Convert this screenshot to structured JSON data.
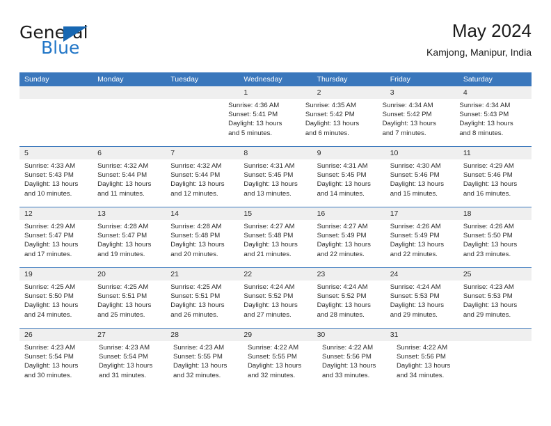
{
  "brand": {
    "word_top": "General",
    "word_bottom": "Blue",
    "accent_color": "#2176c7",
    "triangle_color": "#1767b2"
  },
  "header": {
    "title": "May 2024",
    "subtitle": "Kamjong, Manipur, India"
  },
  "theme": {
    "header_bar_color": "#3a77bc",
    "row_strip_color": "#efefef",
    "text_color": "#2b2b2b"
  },
  "weekday_headers": [
    "Sunday",
    "Monday",
    "Tuesday",
    "Wednesday",
    "Thursday",
    "Friday",
    "Saturday"
  ],
  "weeks": [
    {
      "days": [
        {
          "number": "",
          "sunrise": "",
          "sunset": "",
          "daylight_line1": "",
          "daylight_line2": ""
        },
        {
          "number": "",
          "sunrise": "",
          "sunset": "",
          "daylight_line1": "",
          "daylight_line2": ""
        },
        {
          "number": "",
          "sunrise": "",
          "sunset": "",
          "daylight_line1": "",
          "daylight_line2": ""
        },
        {
          "number": "1",
          "sunrise": "Sunrise: 4:36 AM",
          "sunset": "Sunset: 5:41 PM",
          "daylight_line1": "Daylight: 13 hours",
          "daylight_line2": "and 5 minutes."
        },
        {
          "number": "2",
          "sunrise": "Sunrise: 4:35 AM",
          "sunset": "Sunset: 5:42 PM",
          "daylight_line1": "Daylight: 13 hours",
          "daylight_line2": "and 6 minutes."
        },
        {
          "number": "3",
          "sunrise": "Sunrise: 4:34 AM",
          "sunset": "Sunset: 5:42 PM",
          "daylight_line1": "Daylight: 13 hours",
          "daylight_line2": "and 7 minutes."
        },
        {
          "number": "4",
          "sunrise": "Sunrise: 4:34 AM",
          "sunset": "Sunset: 5:43 PM",
          "daylight_line1": "Daylight: 13 hours",
          "daylight_line2": "and 8 minutes."
        }
      ]
    },
    {
      "days": [
        {
          "number": "5",
          "sunrise": "Sunrise: 4:33 AM",
          "sunset": "Sunset: 5:43 PM",
          "daylight_line1": "Daylight: 13 hours",
          "daylight_line2": "and 10 minutes."
        },
        {
          "number": "6",
          "sunrise": "Sunrise: 4:32 AM",
          "sunset": "Sunset: 5:44 PM",
          "daylight_line1": "Daylight: 13 hours",
          "daylight_line2": "and 11 minutes."
        },
        {
          "number": "7",
          "sunrise": "Sunrise: 4:32 AM",
          "sunset": "Sunset: 5:44 PM",
          "daylight_line1": "Daylight: 13 hours",
          "daylight_line2": "and 12 minutes."
        },
        {
          "number": "8",
          "sunrise": "Sunrise: 4:31 AM",
          "sunset": "Sunset: 5:45 PM",
          "daylight_line1": "Daylight: 13 hours",
          "daylight_line2": "and 13 minutes."
        },
        {
          "number": "9",
          "sunrise": "Sunrise: 4:31 AM",
          "sunset": "Sunset: 5:45 PM",
          "daylight_line1": "Daylight: 13 hours",
          "daylight_line2": "and 14 minutes."
        },
        {
          "number": "10",
          "sunrise": "Sunrise: 4:30 AM",
          "sunset": "Sunset: 5:46 PM",
          "daylight_line1": "Daylight: 13 hours",
          "daylight_line2": "and 15 minutes."
        },
        {
          "number": "11",
          "sunrise": "Sunrise: 4:29 AM",
          "sunset": "Sunset: 5:46 PM",
          "daylight_line1": "Daylight: 13 hours",
          "daylight_line2": "and 16 minutes."
        }
      ]
    },
    {
      "days": [
        {
          "number": "12",
          "sunrise": "Sunrise: 4:29 AM",
          "sunset": "Sunset: 5:47 PM",
          "daylight_line1": "Daylight: 13 hours",
          "daylight_line2": "and 17 minutes."
        },
        {
          "number": "13",
          "sunrise": "Sunrise: 4:28 AM",
          "sunset": "Sunset: 5:47 PM",
          "daylight_line1": "Daylight: 13 hours",
          "daylight_line2": "and 19 minutes."
        },
        {
          "number": "14",
          "sunrise": "Sunrise: 4:28 AM",
          "sunset": "Sunset: 5:48 PM",
          "daylight_line1": "Daylight: 13 hours",
          "daylight_line2": "and 20 minutes."
        },
        {
          "number": "15",
          "sunrise": "Sunrise: 4:27 AM",
          "sunset": "Sunset: 5:48 PM",
          "daylight_line1": "Daylight: 13 hours",
          "daylight_line2": "and 21 minutes."
        },
        {
          "number": "16",
          "sunrise": "Sunrise: 4:27 AM",
          "sunset": "Sunset: 5:49 PM",
          "daylight_line1": "Daylight: 13 hours",
          "daylight_line2": "and 22 minutes."
        },
        {
          "number": "17",
          "sunrise": "Sunrise: 4:26 AM",
          "sunset": "Sunset: 5:49 PM",
          "daylight_line1": "Daylight: 13 hours",
          "daylight_line2": "and 22 minutes."
        },
        {
          "number": "18",
          "sunrise": "Sunrise: 4:26 AM",
          "sunset": "Sunset: 5:50 PM",
          "daylight_line1": "Daylight: 13 hours",
          "daylight_line2": "and 23 minutes."
        }
      ]
    },
    {
      "days": [
        {
          "number": "19",
          "sunrise": "Sunrise: 4:25 AM",
          "sunset": "Sunset: 5:50 PM",
          "daylight_line1": "Daylight: 13 hours",
          "daylight_line2": "and 24 minutes."
        },
        {
          "number": "20",
          "sunrise": "Sunrise: 4:25 AM",
          "sunset": "Sunset: 5:51 PM",
          "daylight_line1": "Daylight: 13 hours",
          "daylight_line2": "and 25 minutes."
        },
        {
          "number": "21",
          "sunrise": "Sunrise: 4:25 AM",
          "sunset": "Sunset: 5:51 PM",
          "daylight_line1": "Daylight: 13 hours",
          "daylight_line2": "and 26 minutes."
        },
        {
          "number": "22",
          "sunrise": "Sunrise: 4:24 AM",
          "sunset": "Sunset: 5:52 PM",
          "daylight_line1": "Daylight: 13 hours",
          "daylight_line2": "and 27 minutes."
        },
        {
          "number": "23",
          "sunrise": "Sunrise: 4:24 AM",
          "sunset": "Sunset: 5:52 PM",
          "daylight_line1": "Daylight: 13 hours",
          "daylight_line2": "and 28 minutes."
        },
        {
          "number": "24",
          "sunrise": "Sunrise: 4:24 AM",
          "sunset": "Sunset: 5:53 PM",
          "daylight_line1": "Daylight: 13 hours",
          "daylight_line2": "and 29 minutes."
        },
        {
          "number": "25",
          "sunrise": "Sunrise: 4:23 AM",
          "sunset": "Sunset: 5:53 PM",
          "daylight_line1": "Daylight: 13 hours",
          "daylight_line2": "and 29 minutes."
        }
      ]
    },
    {
      "days": [
        {
          "number": "26",
          "sunrise": "Sunrise: 4:23 AM",
          "sunset": "Sunset: 5:54 PM",
          "daylight_line1": "Daylight: 13 hours",
          "daylight_line2": "and 30 minutes."
        },
        {
          "number": "27",
          "sunrise": "Sunrise: 4:23 AM",
          "sunset": "Sunset: 5:54 PM",
          "daylight_line1": "Daylight: 13 hours",
          "daylight_line2": "and 31 minutes."
        },
        {
          "number": "28",
          "sunrise": "Sunrise: 4:23 AM",
          "sunset": "Sunset: 5:55 PM",
          "daylight_line1": "Daylight: 13 hours",
          "daylight_line2": "and 32 minutes."
        },
        {
          "number": "29",
          "sunrise": "Sunrise: 4:22 AM",
          "sunset": "Sunset: 5:55 PM",
          "daylight_line1": "Daylight: 13 hours",
          "daylight_line2": "and 32 minutes."
        },
        {
          "number": "30",
          "sunrise": "Sunrise: 4:22 AM",
          "sunset": "Sunset: 5:56 PM",
          "daylight_line1": "Daylight: 13 hours",
          "daylight_line2": "and 33 minutes."
        },
        {
          "number": "31",
          "sunrise": "Sunrise: 4:22 AM",
          "sunset": "Sunset: 5:56 PM",
          "daylight_line1": "Daylight: 13 hours",
          "daylight_line2": "and 34 minutes."
        },
        {
          "number": "",
          "sunrise": "",
          "sunset": "",
          "daylight_line1": "",
          "daylight_line2": ""
        }
      ]
    }
  ]
}
